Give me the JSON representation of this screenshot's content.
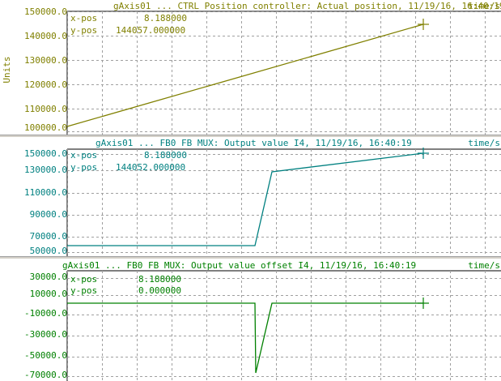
{
  "panels": [
    {
      "title": "gAxis01 ... CTRL Position controller: Actual position, 11/19/16, 16:40:19",
      "unit": "time/s",
      "ylabel": "Units",
      "color": "#808000",
      "yticks": [
        "150000.0",
        "140000.0",
        "130000.0",
        "120000.0",
        "110000.0",
        "100000.0"
      ],
      "cursor": {
        "x_label": "x-pos",
        "x_value": "8.188000",
        "y_label": "y-pos",
        "y_value": "144057.000000"
      }
    },
    {
      "title": "gAxis01 ... FB0 FB MUX: Output value I4, 11/19/16, 16:40:19",
      "unit": "time/s",
      "ylabel": "",
      "color": "#008080",
      "yticks": [
        "150000.0",
        "130000.0",
        "110000.0",
        "90000.0",
        "70000.0",
        "50000.0"
      ],
      "cursor": {
        "x_label": "x-pos",
        "x_value": "8.188000",
        "y_label": "y-pos",
        "y_value": "144052.000000"
      }
    },
    {
      "title": "gAxis01 ... FB0 FB MUX: Output value offset I4, 11/19/16, 16:40:19",
      "unit": "time/s",
      "ylabel": "",
      "color": "#008000",
      "yticks": [
        "30000.0",
        "10000.0",
        "-10000.0",
        "-30000.0",
        "-50000.0",
        "-70000.0"
      ],
      "cursor": {
        "x_label": "x-pos",
        "x_value": "8.188000",
        "y_label": "y-pos",
        "y_value": "0.000000"
      }
    }
  ]
}
